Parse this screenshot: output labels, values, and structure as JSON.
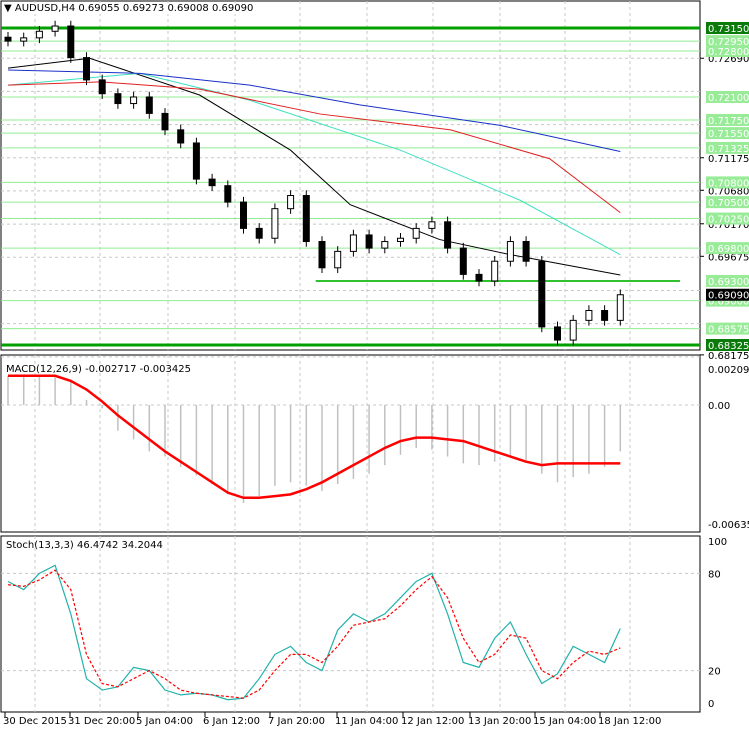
{
  "header": {
    "title": "AUDUSD,H4",
    "ohlc": "0.69055 0.69273 0.69008 0.69090"
  },
  "colors": {
    "ma_black": "#000000",
    "ma_teal": "#40e0c0",
    "ma_red": "#e02020",
    "ma_blue": "#1a30c8",
    "level": "#00a000",
    "level_light": "#90ee90",
    "macd_signal": "#ff0000",
    "macd_hist": "#c0c0c0",
    "stoch_main": "#20b2aa",
    "stoch_signal": "#ff0000"
  },
  "chart_data": [
    {
      "type": "candlestick",
      "title": "AUDUSD,H4",
      "ylim": [
        0.6813,
        0.7335
      ],
      "closes": [
        0.7295,
        0.73,
        0.731,
        0.7318,
        0.727,
        0.7236,
        0.7215,
        0.72,
        0.721,
        0.7185,
        0.716,
        0.714,
        0.7085,
        0.7075,
        0.705,
        0.701,
        0.6995,
        0.704,
        0.706,
        0.699,
        0.695,
        0.6975,
        0.7,
        0.698,
        0.699,
        0.6995,
        0.701,
        0.702,
        0.698,
        0.694,
        0.693,
        0.696,
        0.699,
        0.696,
        0.686,
        0.684,
        0.687,
        0.6885,
        0.687,
        0.6909
      ],
      "moving_averages": [
        {
          "name": "black",
          "points": [
            [
              0,
              0.7254
            ],
            [
              5.2,
              0.7269
            ],
            [
              12.2,
              0.7213
            ],
            [
              18,
              0.7129
            ],
            [
              21.8,
              0.7046
            ],
            [
              27.5,
              0.6993
            ],
            [
              32,
              0.697
            ],
            [
              39,
              0.6939
            ]
          ]
        },
        {
          "name": "teal",
          "points": [
            [
              0,
              0.7228
            ],
            [
              8.4,
              0.7246
            ],
            [
              15.4,
              0.7205
            ],
            [
              25,
              0.7129
            ],
            [
              32.6,
              0.7053
            ],
            [
              39,
              0.697
            ]
          ]
        },
        {
          "name": "red",
          "points": [
            [
              0,
              0.7228
            ],
            [
              5.9,
              0.7233
            ],
            [
              12.2,
              0.7222
            ],
            [
              19.9,
              0.7184
            ],
            [
              28.2,
              0.716
            ],
            [
              34.5,
              0.7116
            ],
            [
              39,
              0.7034
            ]
          ]
        },
        {
          "name": "blue",
          "points": [
            [
              0,
              0.7251
            ],
            [
              8.4,
              0.7246
            ],
            [
              15.4,
              0.7228
            ],
            [
              22.4,
              0.7198
            ],
            [
              31.3,
              0.7167
            ],
            [
              39,
              0.7127
            ]
          ]
        }
      ],
      "levels_major": [
        0.7315,
        0.68325
      ],
      "levels_light": [
        0.7295,
        0.728,
        0.721,
        0.7175,
        0.7155,
        0.71325,
        0.708,
        0.705,
        0.7025,
        0.698,
        0.69,
        0.68575
      ],
      "level_segment": {
        "price": 0.693,
        "from_index": 19.6
      },
      "level_labels": [
        "0.73150",
        "0.72950",
        "0.72800",
        "0.72100",
        "0.71750",
        "0.71550",
        "0.71325",
        "0.70800",
        "0.70500",
        "0.70250",
        "0.69800",
        "0.69300",
        "0.69000",
        "0.68575",
        "0.68325"
      ],
      "scale_labels": [
        "0.72690",
        "0.71175",
        "0.70680",
        "0.70170",
        "0.69675",
        "0.68175"
      ],
      "current_price": "0.69090",
      "x_ticks": [
        "30 Dec 2015",
        "31 Dec 20:00",
        "5 Jan 04:00",
        "6 Jan 12:00",
        "7 Jan 20:00",
        "11 Jan 04:00",
        "12 Jan 12:00",
        "13 Jan 20:00",
        "15 Jan 04:00",
        "18 Jan 12:00"
      ]
    },
    {
      "type": "macd",
      "title": "MACD(12,26,9) -0.002717 -0.003425",
      "ylim": [
        -0.00635,
        0.002095
      ],
      "tick_labels": [
        "0.002095",
        "0.00",
        "-0.00635"
      ],
      "histogram": [
        0.0017,
        0.0017,
        0.0017,
        0.0016,
        0.0014,
        0.0003,
        -0.0002,
        -0.0015,
        -0.002,
        -0.0027,
        -0.003,
        -0.0036,
        -0.0041,
        -0.0046,
        -0.0052,
        -0.0057,
        -0.0053,
        -0.0047,
        -0.0045,
        -0.0047,
        -0.005,
        -0.0046,
        -0.0043,
        -0.004,
        -0.0035,
        -0.0029,
        -0.0025,
        -0.0026,
        -0.003,
        -0.0034,
        -0.0035,
        -0.0033,
        -0.003,
        -0.0032,
        -0.004,
        -0.0045,
        -0.0042,
        -0.004,
        -0.0036,
        -0.0027
      ],
      "signal": [
        0.0017,
        0.0017,
        0.0017,
        0.0017,
        0.0014,
        0.0009,
        0.0002,
        -0.0006,
        -0.0013,
        -0.002,
        -0.0027,
        -0.0033,
        -0.0039,
        -0.0045,
        -0.0051,
        -0.0054,
        -0.0054,
        -0.0053,
        -0.0052,
        -0.0049,
        -0.0045,
        -0.004,
        -0.0035,
        -0.003,
        -0.0025,
        -0.0021,
        -0.0019,
        -0.0019,
        -0.002,
        -0.0021,
        -0.0024,
        -0.0027,
        -0.003,
        -0.0033,
        -0.0035,
        -0.0034,
        -0.0034,
        -0.0034,
        -0.0034,
        -0.0034
      ]
    },
    {
      "type": "stochastic",
      "title": "Stoch(13,3,3) 46.4742 34.2044",
      "ylim": [
        0,
        100
      ],
      "tick_labels": [
        "100",
        "80",
        "20",
        "0"
      ],
      "main": [
        75,
        70,
        80,
        85,
        55,
        15,
        8,
        10,
        22,
        20,
        8,
        5,
        6,
        5,
        2,
        3,
        15,
        30,
        35,
        25,
        20,
        45,
        55,
        50,
        55,
        65,
        75,
        80,
        55,
        25,
        22,
        40,
        50,
        30,
        12,
        18,
        35,
        30,
        25,
        46
      ],
      "signal": [
        73,
        72,
        76,
        82,
        70,
        30,
        12,
        10,
        15,
        20,
        15,
        8,
        6,
        5,
        4,
        3,
        8,
        20,
        30,
        30,
        25,
        35,
        48,
        50,
        52,
        60,
        70,
        78,
        65,
        40,
        25,
        30,
        42,
        40,
        20,
        15,
        25,
        32,
        30,
        34
      ]
    }
  ]
}
